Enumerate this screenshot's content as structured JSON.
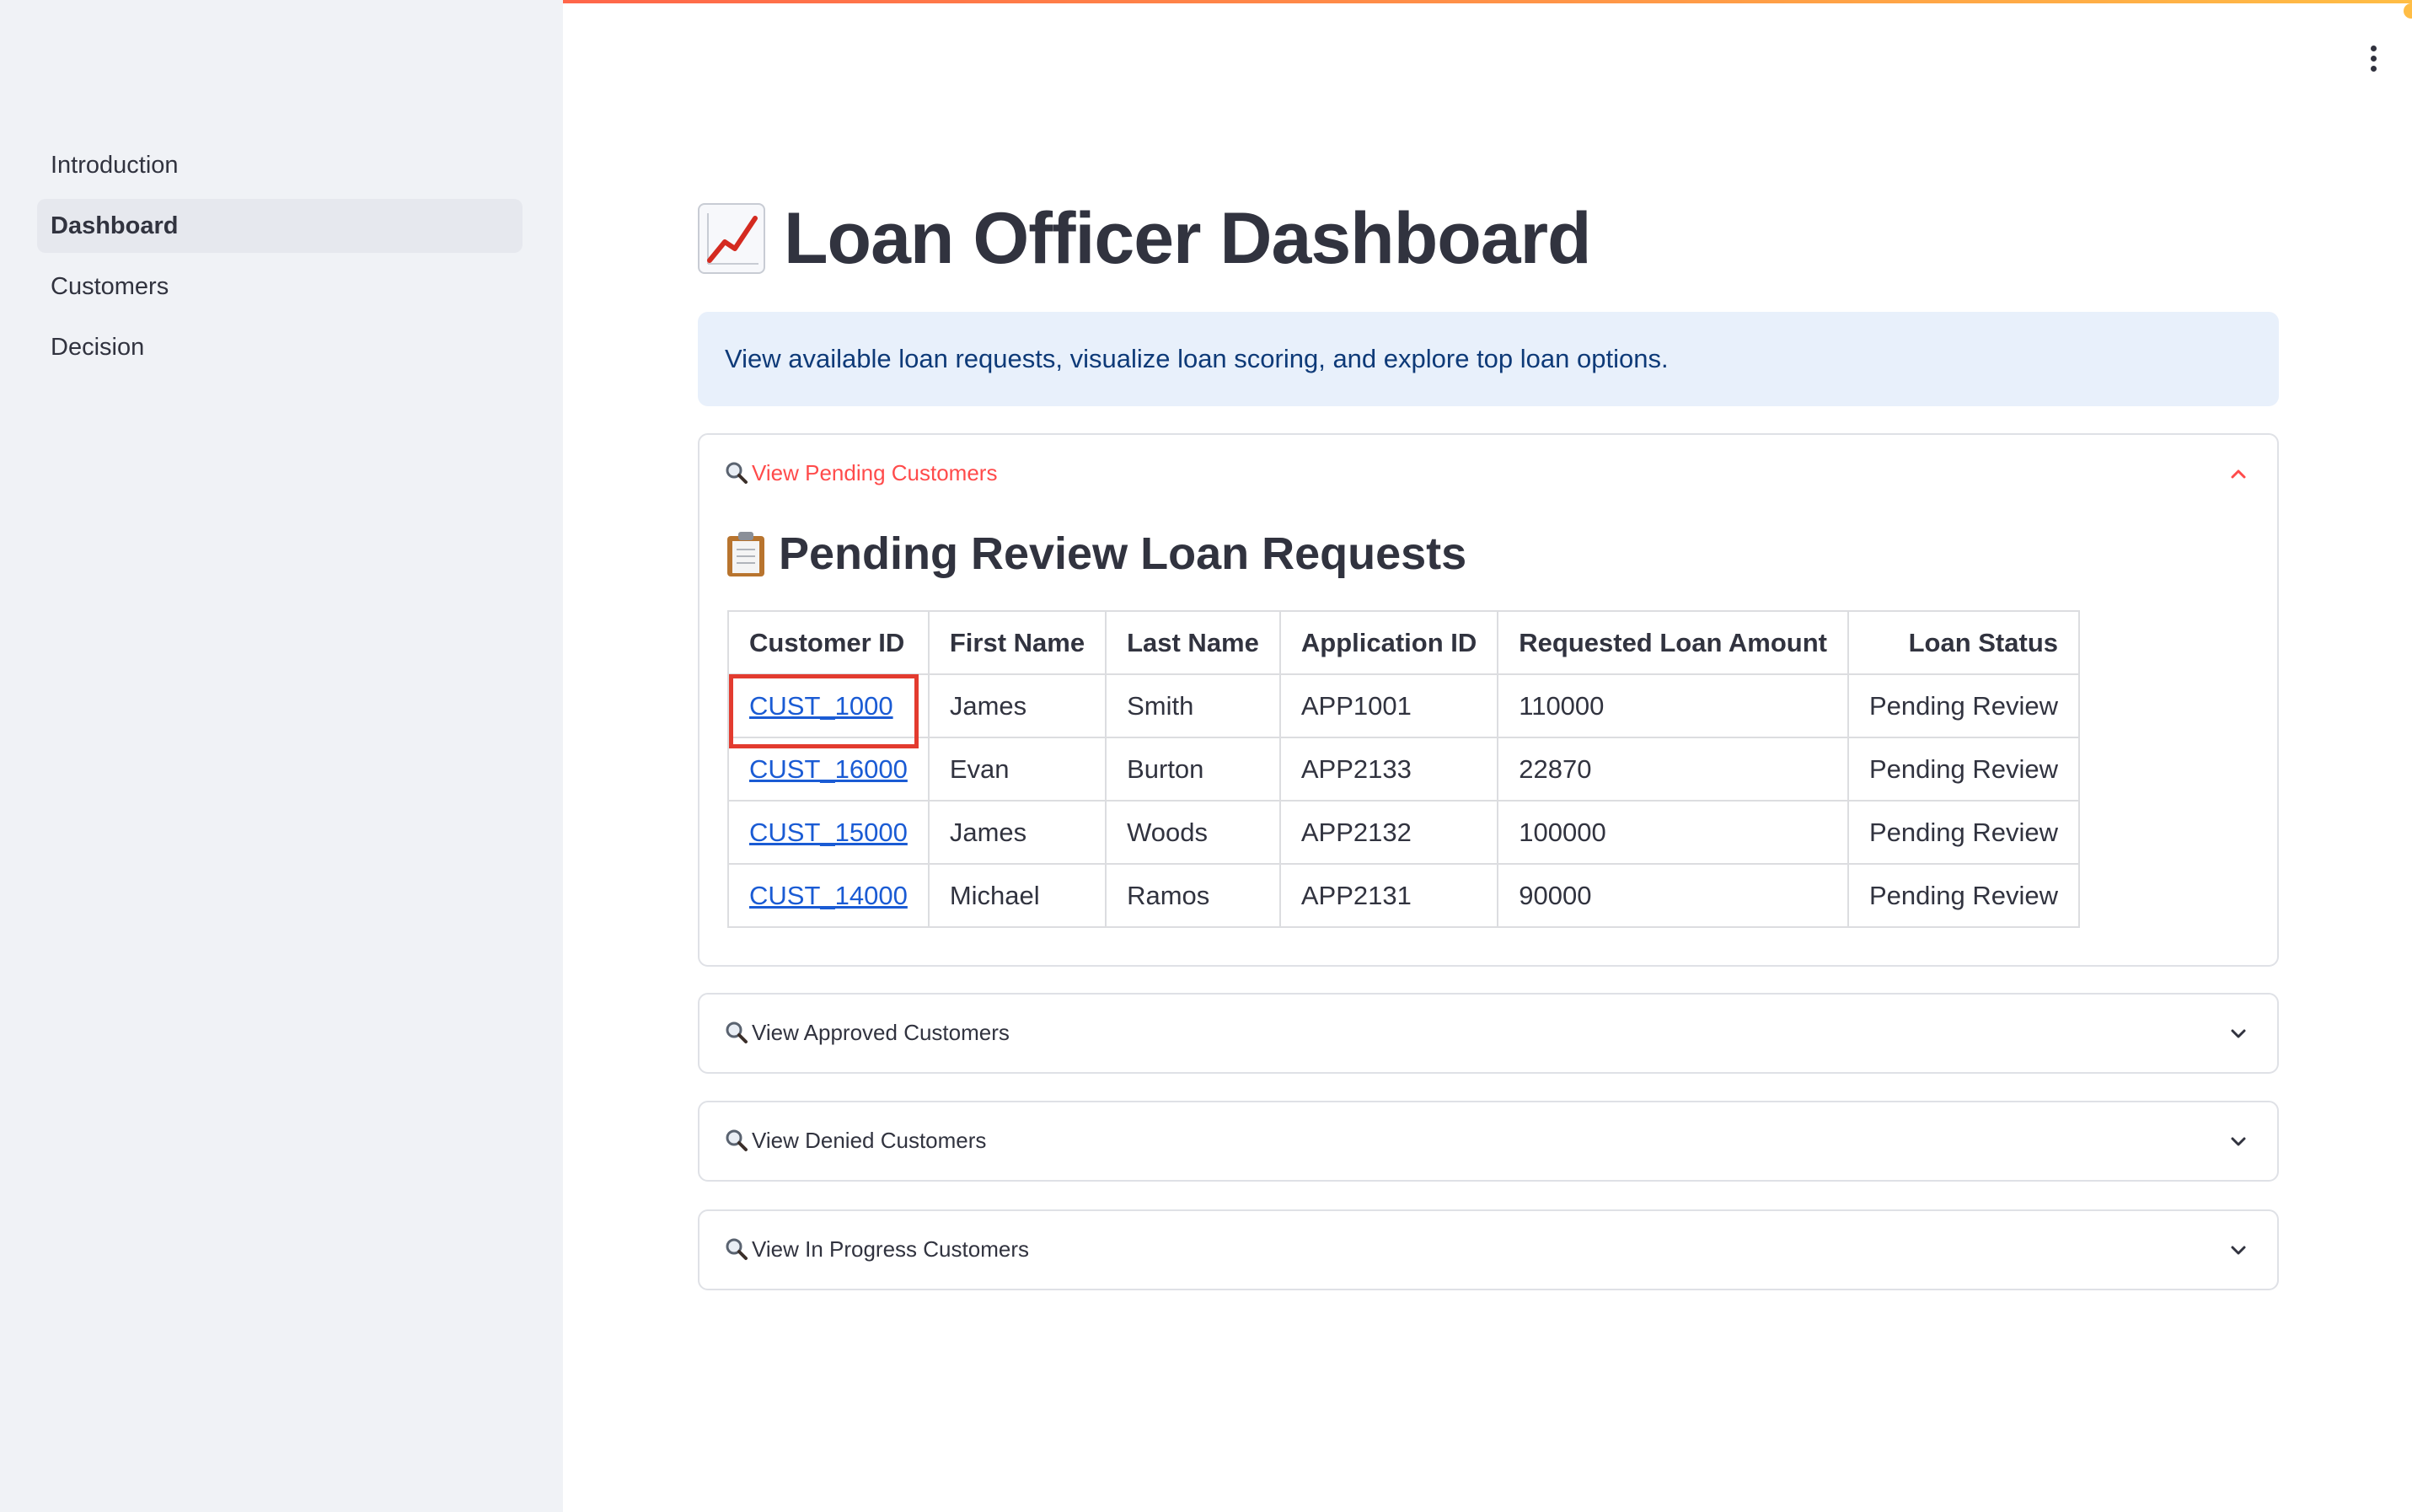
{
  "sidebar": {
    "items": [
      {
        "label": "Introduction",
        "active": false
      },
      {
        "label": "Dashboard",
        "active": true
      },
      {
        "label": "Customers",
        "active": false
      },
      {
        "label": "Decision",
        "active": false
      }
    ]
  },
  "header": {
    "title": "Loan Officer Dashboard",
    "title_icon": "chart-increasing-icon"
  },
  "info": {
    "text": "View available loan requests, visualize loan scoring, and explore top loan options."
  },
  "expanders": {
    "pending": {
      "label": "View Pending Customers",
      "expanded": true,
      "section_title": "Pending Review Loan Requests",
      "section_icon": "clipboard-icon",
      "columns": [
        "Customer ID",
        "First Name",
        "Last Name",
        "Application ID",
        "Requested Loan Amount",
        "Loan Status"
      ],
      "rows": [
        {
          "customer_id": "CUST_1000",
          "first_name": "James",
          "last_name": "Smith",
          "application_id": "APP1001",
          "amount": "110000",
          "status": "Pending Review"
        },
        {
          "customer_id": "CUST_16000",
          "first_name": "Evan",
          "last_name": "Burton",
          "application_id": "APP2133",
          "amount": "22870",
          "status": "Pending Review"
        },
        {
          "customer_id": "CUST_15000",
          "first_name": "James",
          "last_name": "Woods",
          "application_id": "APP2132",
          "amount": "100000",
          "status": "Pending Review"
        },
        {
          "customer_id": "CUST_14000",
          "first_name": "Michael",
          "last_name": "Ramos",
          "application_id": "APP2131",
          "amount": "90000",
          "status": "Pending Review"
        }
      ]
    },
    "approved": {
      "label": "View Approved Customers",
      "expanded": false
    },
    "denied": {
      "label": "View Denied Customers",
      "expanded": false
    },
    "in_progress": {
      "label": "View In Progress Customers",
      "expanded": false
    }
  },
  "colors": {
    "accent": "#ff4b4b",
    "link": "#1a5bd4",
    "info_bg": "#e8f0fb",
    "info_text": "#0e3a78",
    "sidebar_bg": "#f0f2f6",
    "highlight": "#e33b2f"
  }
}
